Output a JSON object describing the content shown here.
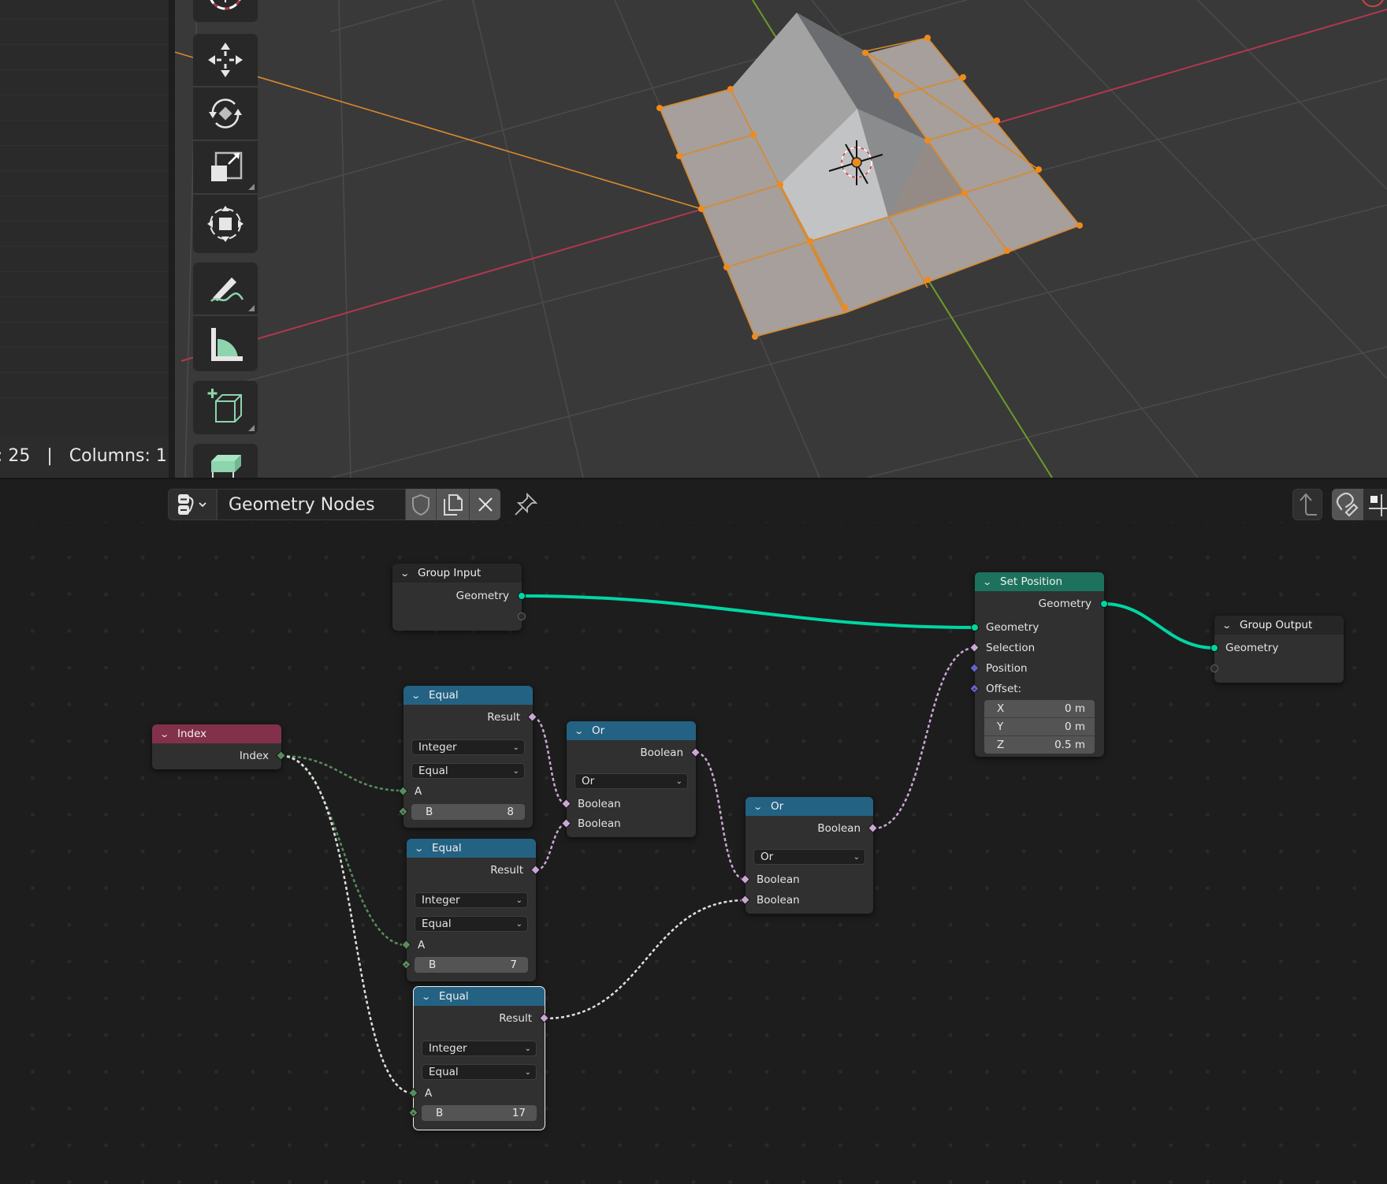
{
  "viewport": {
    "status_text": ": 25   |   Columns: 1",
    "toolbar": [
      {
        "name": "cursor-tool"
      },
      {
        "name": "move-tool"
      },
      {
        "name": "rotate-tool"
      },
      {
        "name": "scale-tool"
      },
      {
        "name": "transform-tool"
      },
      {
        "name": "annotate-tool"
      },
      {
        "name": "measure-tool"
      },
      {
        "name": "add-cube-tool"
      },
      {
        "name": "extrude-tool"
      }
    ],
    "colors": {
      "x_axis": "#b0384f",
      "y_axis": "#6f9a2a",
      "selection": "#f08a1c",
      "mesh": "#a69f9b"
    }
  },
  "header": {
    "editor_type_icon": "node-editor-icon",
    "nodegroup_name": "Geometry Nodes",
    "fake_user_icon": "shield-icon",
    "duplicate_icon": "duplicate-icon",
    "unlink_icon": "close-icon",
    "pin_icon": "pin-icon",
    "parent_icon": "arrow-up-icon",
    "snap_icon": "magnet-icon",
    "snap_mode_icon": "snap-grid-icon"
  },
  "nodes": {
    "group_input": {
      "title": "Group Input",
      "out_geometry": "Geometry",
      "color": "#262626"
    },
    "set_position": {
      "title": "Set Position",
      "color": "#1d725e",
      "out_geometry": "Geometry",
      "in_geometry": "Geometry",
      "in_selection": "Selection",
      "in_position": "Position",
      "in_offset": "Offset:",
      "offset": [
        {
          "axis": "X",
          "value": "0 m"
        },
        {
          "axis": "Y",
          "value": "0 m"
        },
        {
          "axis": "Z",
          "value": "0.5 m"
        }
      ]
    },
    "group_output": {
      "title": "Group Output",
      "in_geometry": "Geometry"
    },
    "index": {
      "title": "Index",
      "out_index": "Index",
      "color": "#83314a"
    },
    "equal_1": {
      "title": "Equal",
      "out_result": "Result",
      "data_type": "Integer",
      "mode": "Equal",
      "in_a": "A",
      "in_b_label": "B",
      "in_b_value": "8"
    },
    "equal_2": {
      "title": "Equal",
      "out_result": "Result",
      "data_type": "Integer",
      "mode": "Equal",
      "in_a": "A",
      "in_b_label": "B",
      "in_b_value": "7"
    },
    "equal_3": {
      "title": "Equal",
      "out_result": "Result",
      "data_type": "Integer",
      "mode": "Equal",
      "in_a": "A",
      "in_b_label": "B",
      "in_b_value": "17"
    },
    "or_1": {
      "title": "Or",
      "out_boolean": "Boolean",
      "operation": "Or",
      "in_1": "Boolean",
      "in_2": "Boolean"
    },
    "or_2": {
      "title": "Or",
      "out_boolean": "Boolean",
      "operation": "Or",
      "in_1": "Boolean",
      "in_2": "Boolean"
    },
    "header_color_converter": "#246283"
  }
}
